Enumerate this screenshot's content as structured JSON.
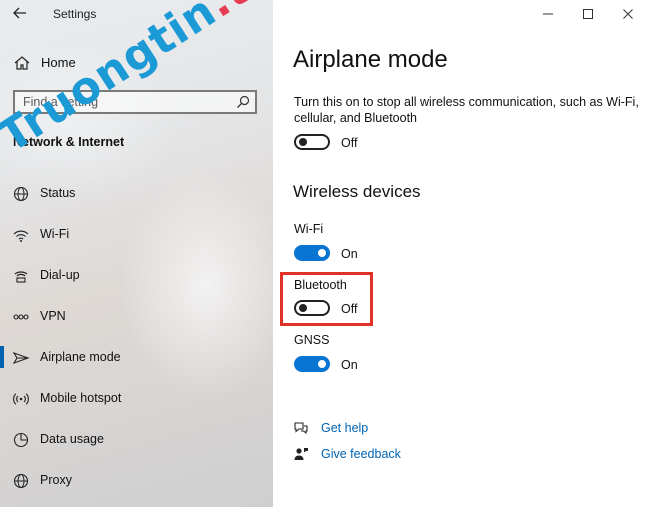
{
  "window": {
    "title": "Settings"
  },
  "sidebar": {
    "home_label": "Home",
    "search_placeholder": "Find a setting",
    "section_title": "Network & Internet",
    "items": [
      {
        "label": "Status",
        "icon": "globe-icon"
      },
      {
        "label": "Wi-Fi",
        "icon": "wifi-icon"
      },
      {
        "label": "Dial-up",
        "icon": "dialup-icon"
      },
      {
        "label": "VPN",
        "icon": "vpn-icon"
      },
      {
        "label": "Airplane mode",
        "icon": "airplane-icon",
        "selected": true
      },
      {
        "label": "Mobile hotspot",
        "icon": "hotspot-icon"
      },
      {
        "label": "Data usage",
        "icon": "data-usage-icon"
      },
      {
        "label": "Proxy",
        "icon": "globe-icon"
      }
    ]
  },
  "watermark": {
    "part1": "Truongtin",
    "part2": ".top"
  },
  "main": {
    "title": "Airplane mode",
    "description": "Turn this on to stop all wireless communication, such as Wi-Fi, cellular, and Bluetooth",
    "airplane_toggle": {
      "state": "Off"
    },
    "wireless_heading": "Wireless devices",
    "devices": [
      {
        "name": "Wi-Fi",
        "state": "On"
      },
      {
        "name": "Bluetooth",
        "state": "Off"
      },
      {
        "name": "GNSS",
        "state": "On"
      }
    ],
    "links": {
      "help": "Get help",
      "feedback": "Give feedback"
    }
  },
  "colors": {
    "accent": "#0a74d3",
    "link": "#0063b1",
    "highlight": "#e13228",
    "watermark_blue": "#1b9ad6",
    "watermark_red": "#e53c52"
  }
}
